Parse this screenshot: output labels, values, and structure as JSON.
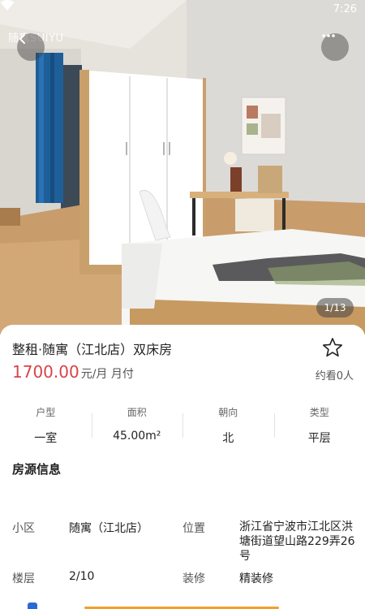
{
  "status_bar": {
    "time": "7:26",
    "wifi_icon": "wifi-icon"
  },
  "gallery": {
    "watermark": "随寓SUIYU",
    "counter": "1/13",
    "back_icon": "chevron-left-icon",
    "more_icon": "more-horizontal-icon"
  },
  "listing": {
    "title": "整租·随寓（江北店）双床房",
    "price": "1700.00",
    "price_unit": "元/月 月付",
    "views": "约看0人",
    "favorite_icon": "star-outline-icon",
    "accent_color": "#d9434a"
  },
  "attributes": [
    {
      "label": "户型",
      "value": "一室"
    },
    {
      "label": "面积",
      "value": "45.00m²"
    },
    {
      "label": "朝向",
      "value": "北"
    },
    {
      "label": "类型",
      "value": "平层"
    }
  ],
  "info": {
    "section_title": "房源信息",
    "community_label": "小区",
    "community_value": "随寓（江北店）",
    "location_label": "位置",
    "location_value": "浙江省宁波市江北区洪塘街道望山路229弄26号",
    "floor_label": "楼层",
    "floor_value": "2/10",
    "decoration_label": "装修",
    "decoration_value": "精装修"
  }
}
